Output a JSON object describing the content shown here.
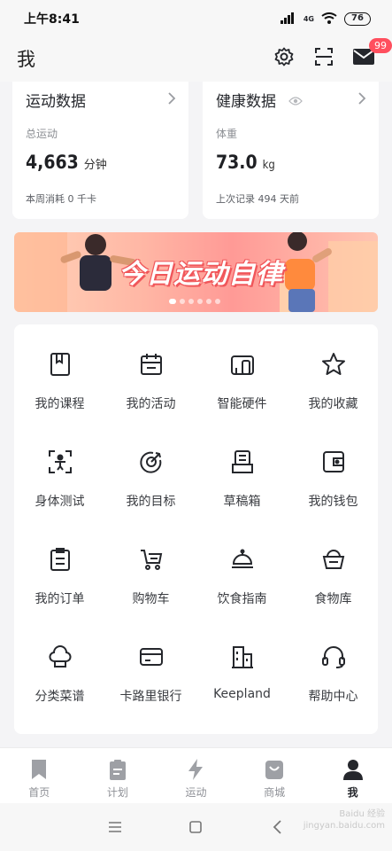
{
  "status_bar": {
    "time": "上午8:41",
    "network": "4G",
    "battery": "76"
  },
  "header": {
    "title": "我",
    "settings_icon": "gear-icon",
    "scan_icon": "scan-icon",
    "mail_icon": "mail-icon",
    "mail_badge": "99"
  },
  "cards": {
    "exercise": {
      "title": "运动数据",
      "label": "总运动",
      "value": "4,663",
      "unit": "分钟",
      "footer": "本周消耗 0 千卡"
    },
    "health": {
      "title": "健康数据",
      "label": "体重",
      "value": "73.0",
      "unit": "kg",
      "footer": "上次记录 494 天前"
    }
  },
  "banner": {
    "text": "今日运动自律",
    "slide_count": 6,
    "active_slide": 1
  },
  "grid": {
    "items": [
      {
        "label": "我的课程",
        "icon": "book-icon"
      },
      {
        "label": "我的活动",
        "icon": "calendar-icon"
      },
      {
        "label": "智能硬件",
        "icon": "devices-icon"
      },
      {
        "label": "我的收藏",
        "icon": "star-icon"
      },
      {
        "label": "身体测试",
        "icon": "body-scan-icon"
      },
      {
        "label": "我的目标",
        "icon": "target-icon"
      },
      {
        "label": "草稿箱",
        "icon": "drafts-icon"
      },
      {
        "label": "我的钱包",
        "icon": "wallet-icon"
      },
      {
        "label": "我的订单",
        "icon": "order-icon"
      },
      {
        "label": "购物车",
        "icon": "cart-icon"
      },
      {
        "label": "饮食指南",
        "icon": "cloche-icon"
      },
      {
        "label": "食物库",
        "icon": "food-basket-icon"
      },
      {
        "label": "分类菜谱",
        "icon": "chef-hat-icon"
      },
      {
        "label": "卡路里银行",
        "icon": "card-icon"
      },
      {
        "label": "Keepland",
        "icon": "building-icon"
      },
      {
        "label": "帮助中心",
        "icon": "headset-icon"
      }
    ]
  },
  "tabs": [
    {
      "label": "首页",
      "icon": "bookmark-icon",
      "active": false
    },
    {
      "label": "计划",
      "icon": "clipboard-icon",
      "active": false
    },
    {
      "label": "运动",
      "icon": "lightning-icon",
      "active": false
    },
    {
      "label": "商城",
      "icon": "shopping-bag-icon",
      "active": false
    },
    {
      "label": "我",
      "icon": "person-icon",
      "active": true
    }
  ],
  "watermark": {
    "line1": "Baidu 经验",
    "line2": "jingyan.baidu.com"
  },
  "colors": {
    "accent": "#24262b",
    "badge": "#ff4f5e",
    "muted": "#8e9096"
  }
}
